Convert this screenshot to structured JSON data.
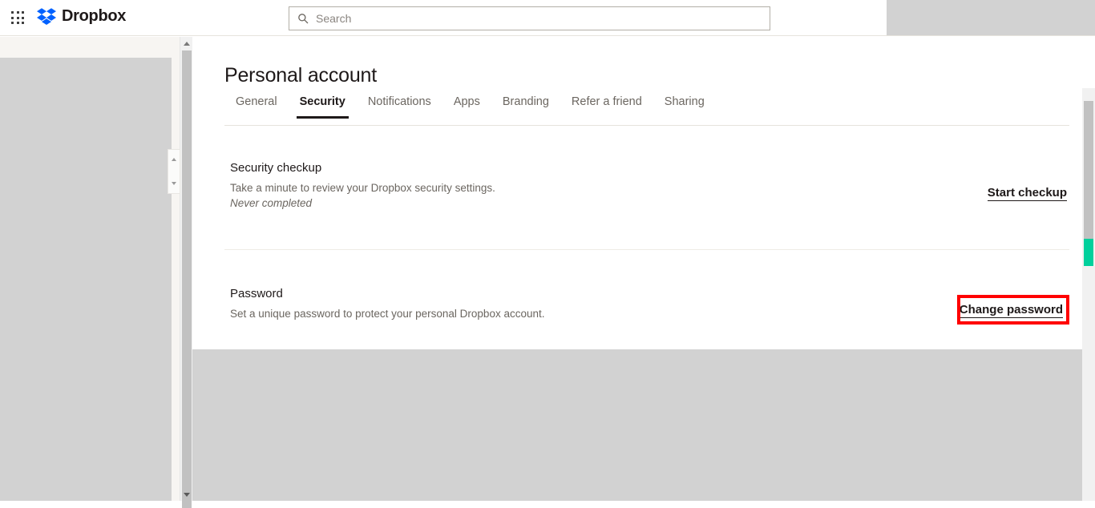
{
  "header": {
    "app_grid_icon": "grid-apps-icon",
    "brand_name": "Dropbox",
    "brand_icon": "dropbox-logo-icon",
    "brand_color": "#0061FF",
    "search": {
      "icon": "search-icon",
      "placeholder": "Search",
      "value": ""
    }
  },
  "page": {
    "title": "Personal account"
  },
  "tabs": [
    {
      "label": "General",
      "active": false
    },
    {
      "label": "Security",
      "active": true
    },
    {
      "label": "Notifications",
      "active": false
    },
    {
      "label": "Apps",
      "active": false
    },
    {
      "label": "Branding",
      "active": false
    },
    {
      "label": "Refer a friend",
      "active": false
    },
    {
      "label": "Sharing",
      "active": false
    }
  ],
  "sections": [
    {
      "title": "Security checkup",
      "description": "Take a minute to review your Dropbox security settings.",
      "note": "Never completed",
      "action_label": "Start checkup"
    },
    {
      "title": "Password",
      "description": "Set a unique password to protect your personal Dropbox account.",
      "action_label": "Change password"
    }
  ],
  "annotation": {
    "highlight_color": "#ff0000",
    "highlight_target": "Change password"
  },
  "scrollbars": {
    "left_up_arrow": "scroll-up-arrow-icon",
    "left_down_arrow": "scroll-down-arrow-icon",
    "right_accent_color": "#00d09c"
  }
}
